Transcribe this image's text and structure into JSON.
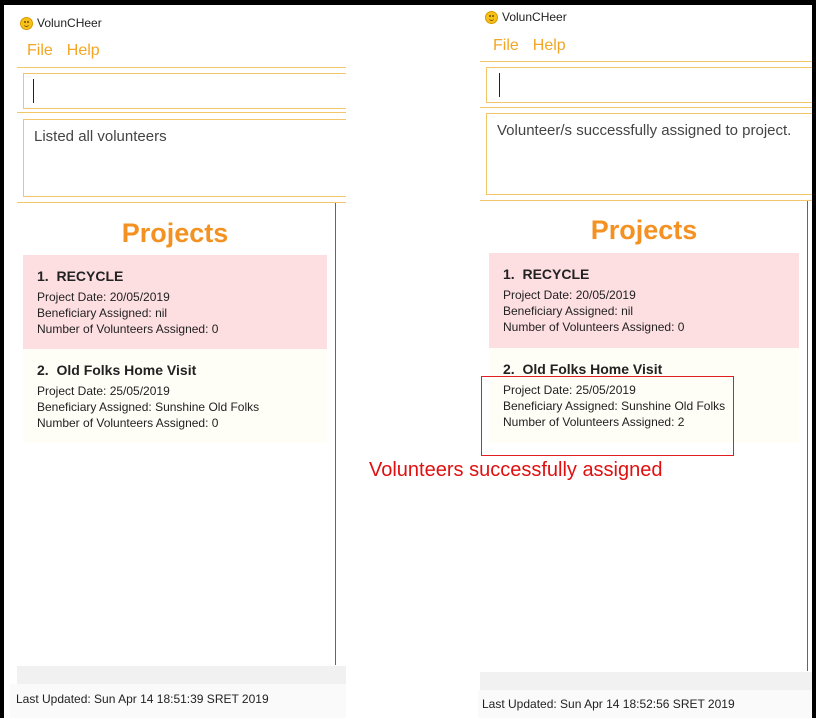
{
  "left": {
    "app_title": "VolunCHeer",
    "menu": [
      "File",
      "Help"
    ],
    "command_value": "",
    "result": "Listed all volunteers",
    "panel_title": "Projects",
    "projects": [
      {
        "index": "1.",
        "name": "RECYCLE",
        "date": "Project Date: 20/05/2019",
        "beneficiary": "Beneficiary Assigned: nil",
        "volunteers": "Number of Volunteers Assigned: 0"
      },
      {
        "index": "2.",
        "name": "Old Folks Home Visit",
        "date": "Project Date: 25/05/2019",
        "beneficiary": "Beneficiary Assigned: Sunshine Old Folks",
        "volunteers": "Number of Volunteers Assigned: 0"
      }
    ],
    "last_updated": "Last Updated: Sun Apr 14 18:51:39 SRET 2019"
  },
  "right": {
    "app_title": "VolunCHeer",
    "menu": [
      "File",
      "Help"
    ],
    "command_value": "",
    "result": "Volunteer/s successfully assigned to project.",
    "panel_title": "Projects",
    "projects": [
      {
        "index": "1.",
        "name": "RECYCLE",
        "date": "Project Date: 20/05/2019",
        "beneficiary": "Beneficiary Assigned: nil",
        "volunteers": "Number of Volunteers Assigned: 0"
      },
      {
        "index": "2.",
        "name": "Old Folks Home Visit",
        "date": "Project Date: 25/05/2019",
        "beneficiary": "Beneficiary Assigned: Sunshine Old Folks",
        "volunteers": "Number of Volunteers Assigned: 2"
      }
    ],
    "last_updated": "Last Updated: Sun Apr 14 18:52:56 SRET 2019"
  },
  "annotation": "Volunteers successfully assigned",
  "colors": {
    "accent": "#f39222",
    "menu": "#f3a625",
    "card_pink": "#fddfe2",
    "card_cream": "#fefdf6",
    "annotation": "#e01010"
  }
}
